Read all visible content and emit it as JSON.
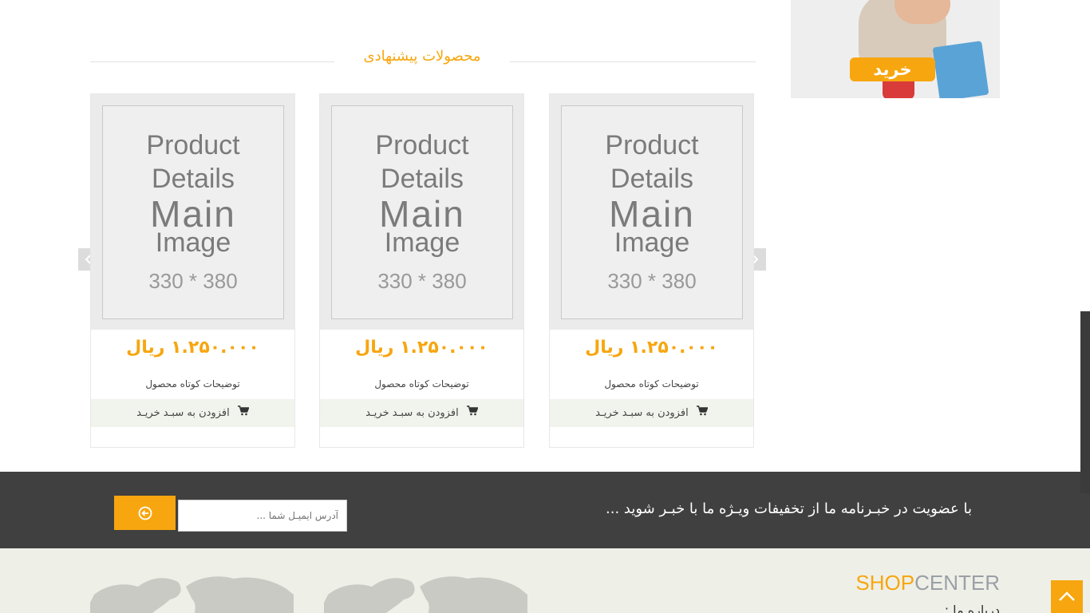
{
  "banner": {
    "button_label": "خرید"
  },
  "section": {
    "title": "محصولات پیشنهادی"
  },
  "products": [
    {
      "placeholder": {
        "line1": "Product",
        "line2": "Details",
        "line3": "Main",
        "line4": "Image",
        "line5": "330 * 380"
      },
      "price": "۱.۲۵۰.۰۰۰ ریال",
      "description": "توضیحات کوتاه محصول",
      "add_to_cart": "افزودن به سبـد خریـد"
    },
    {
      "placeholder": {
        "line1": "Product",
        "line2": "Details",
        "line3": "Main",
        "line4": "Image",
        "line5": "330 * 380"
      },
      "price": "۱.۲۵۰.۰۰۰ ریال",
      "description": "توضیحات کوتاه محصول",
      "add_to_cart": "افزودن به سبـد خریـد"
    },
    {
      "placeholder": {
        "line1": "Product",
        "line2": "Details",
        "line3": "Main",
        "line4": "Image",
        "line5": "330 * 380"
      },
      "price": "۱.۲۵۰.۰۰۰ ریال",
      "description": "توضیحات کوتاه محصول",
      "add_to_cart": "افزودن به سبـد خریـد"
    }
  ],
  "newsletter": {
    "text": "با عضویت در خبـرنامه ما از تخفیفات ویـژه ما با خبـر شوید ...",
    "email_placeholder": "آدرس ایمیـل شما ..."
  },
  "footer": {
    "brand_part1": "SHOP",
    "brand_part2": "CENTER",
    "about_label": "درباره ما :"
  },
  "colors": {
    "accent": "#f7a60f",
    "dark_bar": "#404040",
    "footer_bg": "#eef0e8"
  },
  "icons": {
    "cart": "cart-icon",
    "next": "chevron-right-icon",
    "prev": "chevron-left-icon",
    "submit": "arrow-circle-icon",
    "top": "chevron-up-icon"
  }
}
